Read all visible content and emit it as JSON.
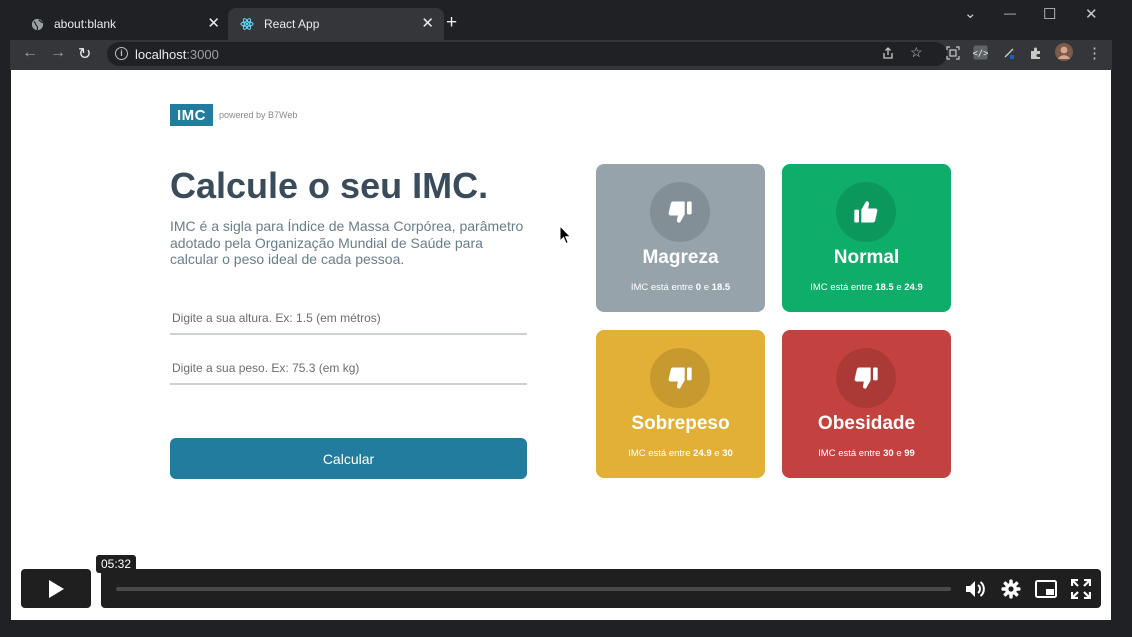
{
  "browser": {
    "tabs": [
      {
        "title": "about:blank",
        "icon": "globe-icon",
        "close": "✕"
      },
      {
        "title": "React App",
        "icon": "react-icon",
        "close": "✕"
      }
    ],
    "new_tab": "+",
    "window_controls": {
      "dropdown": "⌄",
      "minimize": "—",
      "maximize": "☐",
      "close": "✕"
    },
    "url": {
      "host": "localhost",
      "port": ":3000"
    }
  },
  "app": {
    "logo": "IMC",
    "powered_by": "powered by B7Web",
    "heading": "Calcule o seu IMC.",
    "description": "IMC é a sigla para Índice de Massa Corpórea, parâmetro adotado pela Organização Mundial de Saúde para calcular o peso ideal de cada pessoa.",
    "height_placeholder": "Digite a sua altura. Ex: 1.5 (em métros)",
    "weight_placeholder": "Digite a sua peso. Ex: 75.3 (em kg)",
    "button_label": "Calcular",
    "range_prefix": "IMC está entre",
    "range_and": "e",
    "cards": [
      {
        "title": "Magreza",
        "min": "0",
        "max": "18.5",
        "icon": "thumbs-down-icon",
        "color": "#96a3ab"
      },
      {
        "title": "Normal",
        "min": "18.5",
        "max": "24.9",
        "icon": "thumbs-up-icon",
        "color": "#0ead69"
      },
      {
        "title": "Sobrepeso",
        "min": "24.9",
        "max": "30",
        "icon": "thumbs-down-icon",
        "color": "#e2b036"
      },
      {
        "title": "Obesidade",
        "min": "30",
        "max": "99",
        "icon": "thumbs-down-icon",
        "color": "#c3423f"
      }
    ]
  },
  "video": {
    "time": "05:32",
    "progress": 0.0
  }
}
